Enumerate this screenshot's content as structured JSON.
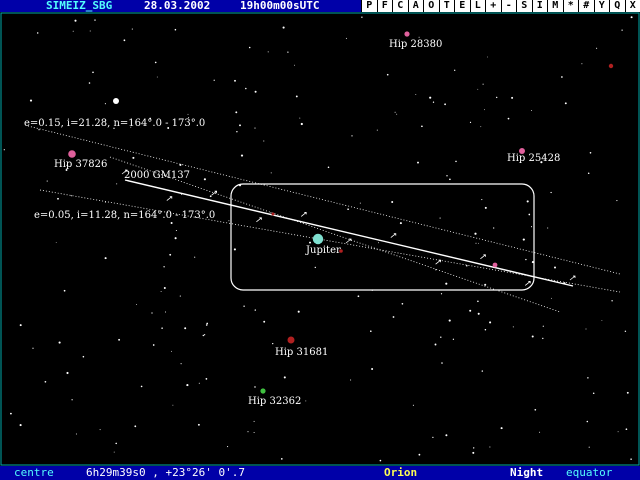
{
  "header": {
    "site": "SIMEIZ_SBG",
    "date": "28.03.2002",
    "time": "19h00m00sUTC"
  },
  "menu": [
    "P",
    "F",
    "C",
    "A",
    "O",
    "T",
    "E",
    "L",
    "+",
    "-",
    "S",
    "I",
    "M",
    "*",
    "#",
    "Y",
    "Q",
    "X"
  ],
  "sky": {
    "objects": [
      {
        "label": "Hip 28380",
        "color": "#e0609c"
      },
      {
        "label": "Hip 37826",
        "color": "#e0609c"
      },
      {
        "label": "Hip 25428",
        "color": "#e0609c"
      },
      {
        "label": "Jupiter",
        "color": "#7fe0d0"
      },
      {
        "label": "Hip 31681",
        "color": "#b02020"
      },
      {
        "label": "Hip 32362",
        "color": "#40c040"
      }
    ],
    "orbit_labels": [
      "e=0.15, i=21.28, n=164°.0 - 173°.0",
      "2000 GM137",
      "e=0.05, i=11.28, n=164°.0 - 173°.0"
    ]
  },
  "status": {
    "mode": "centre",
    "coords": "6h29m39s0 , +23°26' 0'.7",
    "constellation": "Orion",
    "display": "Night",
    "frame": "equator"
  },
  "colors": {
    "bar": "#0000a8",
    "accent": "#54fcfc",
    "yellow": "#fcfc54",
    "white": "#ffffff"
  }
}
